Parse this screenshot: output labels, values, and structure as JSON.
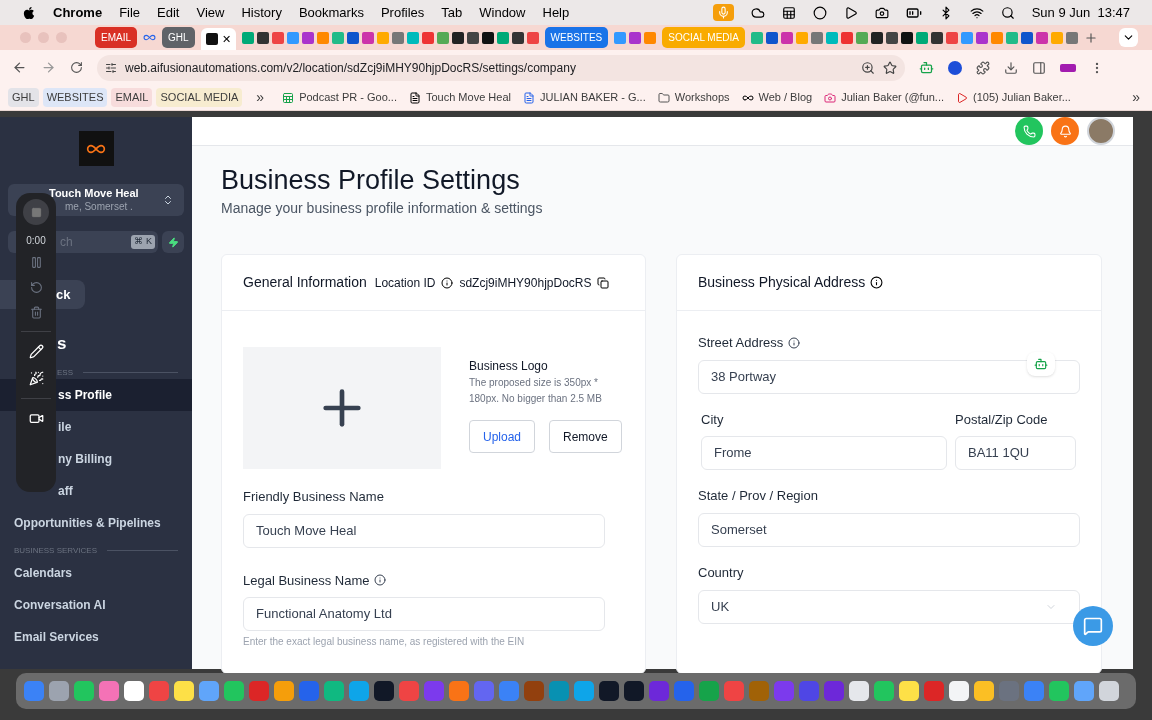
{
  "menu_bar": {
    "app": "Chrome",
    "menus": [
      "File",
      "Edit",
      "View",
      "History",
      "Bookmarks",
      "Profiles",
      "Tab",
      "Window",
      "Help"
    ],
    "clock": "Sun 9 Jun  13:47"
  },
  "tab_strip": [
    {
      "kind": "group",
      "label": "EMAIL",
      "color": "#d93025"
    },
    {
      "kind": "favicon"
    },
    {
      "kind": "group",
      "label": "GHL",
      "color": "#5f6368"
    },
    {
      "kind": "active",
      "close": "✕"
    },
    {
      "kind": "favicons"
    },
    {
      "kind": "group",
      "label": "WEBSITES",
      "color": "#1a73e8"
    },
    {
      "kind": "favicons"
    },
    {
      "kind": "group",
      "label": "SOCIAL MEDIA",
      "color": "#f9ab00"
    },
    {
      "kind": "favicons"
    }
  ],
  "address_bar": {
    "url": "web.aifusionautomations.com/v2/location/sdZcj9iMHY90hjpDocRS/settings/company"
  },
  "bookmarks": [
    {
      "kind": "group",
      "label": "GHL",
      "color": "#e3e3e8"
    },
    {
      "kind": "group",
      "label": "WEBSITES",
      "color": "#dde6f7"
    },
    {
      "kind": "group",
      "label": "EMAIL",
      "color": "#f7dcdc"
    },
    {
      "kind": "group",
      "label": "SOCIAL MEDIA",
      "color": "#f7ecd0"
    },
    {
      "kind": "more",
      "label": "»"
    },
    {
      "kind": "sheet",
      "label": "Podcast PR - Goo..."
    },
    {
      "kind": "notion",
      "label": "Touch Move Heal"
    },
    {
      "kind": "doc",
      "label": "JULIAN BAKER - G..."
    },
    {
      "kind": "folder",
      "label": "Workshops"
    },
    {
      "kind": "loop",
      "label": "Web / Blog"
    },
    {
      "kind": "insta",
      "label": "Julian Baker (@fun..."
    },
    {
      "kind": "video",
      "label": "(105) Julian Baker..."
    }
  ],
  "bookmarks_more": "»",
  "sidebar": {
    "account": {
      "name": "Touch Move Heal",
      "location": "me, Somerset ."
    },
    "search": {
      "placeholder": "ch",
      "shortcut": "⌘ K"
    },
    "back_button": "ck",
    "heading_parts": [
      "s"
    ],
    "sections": [
      {
        "title": "ESS",
        "items": [
          {
            "label": "ss Profile",
            "selected": true
          },
          {
            "label": "ile",
            "selected": false
          },
          {
            "label": "ny Billing",
            "selected": false
          },
          {
            "label": "aff",
            "selected": false
          },
          {
            "label": "Opportunities & Pipelines",
            "selected": false
          }
        ]
      },
      {
        "title": "BUSINESS SERVICES",
        "items": [
          {
            "label": "Calendars",
            "selected": false
          },
          {
            "label": "Conversation AI",
            "selected": false
          },
          {
            "label": "Email Services",
            "selected": false
          }
        ]
      }
    ]
  },
  "recorder": {
    "time": "0:00"
  },
  "page": {
    "title": "Business Profile Settings",
    "subtitle": "Manage your business profile information & settings"
  },
  "general_card": {
    "title": "General Information",
    "location_id_label": "Location ID",
    "location_id": "sdZcj9iMHY90hjpDocRS",
    "logo_title": "Business Logo",
    "logo_hint": "The proposed size is 350px * 180px. No bigger than 2.5 MB",
    "upload": "Upload",
    "remove": "Remove",
    "fields": [
      {
        "label": "Friendly Business Name",
        "value": "Touch Move Heal",
        "info": false
      },
      {
        "label": "Legal Business Name",
        "value": "Functional Anatomy Ltd",
        "info": true,
        "hint": "Enter the exact legal business name, as registered with the EIN"
      }
    ]
  },
  "address_card": {
    "title": "Business Physical Address",
    "street": {
      "label": "Street Address",
      "value": "38 Portway"
    },
    "city": {
      "label": "City",
      "value": "Frome"
    },
    "postal": {
      "label": "Postal/Zip Code",
      "value": "BA11 1QU"
    },
    "state": {
      "label": "State / Prov / Region",
      "value": "Somerset"
    },
    "country": {
      "label": "Country",
      "value": "UK"
    }
  }
}
